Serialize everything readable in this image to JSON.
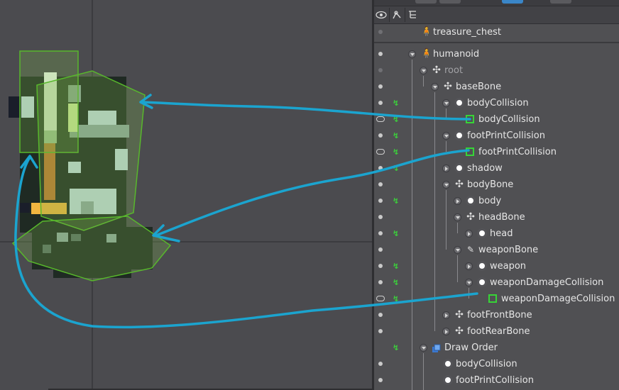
{
  "app": {
    "panel": "tree-view"
  },
  "header": {
    "icons": [
      "eye-icon",
      "bone-pose-icon",
      "tree-list-icon"
    ]
  },
  "tree": {
    "skeleton_asset": "treasure_chest",
    "skeleton": "humanoid",
    "root": "root",
    "baseBone": "baseBone",
    "bodyCollision_slot": "bodyCollision",
    "bodyCollision_box": "bodyCollision",
    "footPrintCollision_slot": "footPrintCollision",
    "footPrintCollision_box": "footPrintCollision",
    "shadow": "shadow",
    "bodyBone": "bodyBone",
    "body": "body",
    "headBone": "headBone",
    "head": "head",
    "weaponBone": "weaponBone",
    "weapon": "weapon",
    "weaponDamageCollision_slot": "weaponDamageCollision",
    "weaponDamageCollision_box": "weaponDamageCollision",
    "footFrontBone": "footFrontBone",
    "footRearBone": "footRearBone",
    "draw_order": "Draw Order",
    "draw_bodyCollision": "bodyCollision",
    "draw_footPrintCollision": "footPrintCollision"
  },
  "colors": {
    "annotation": "#1ba4cf",
    "bbox": "#58b82c",
    "bbox_tree": "#37d437"
  }
}
